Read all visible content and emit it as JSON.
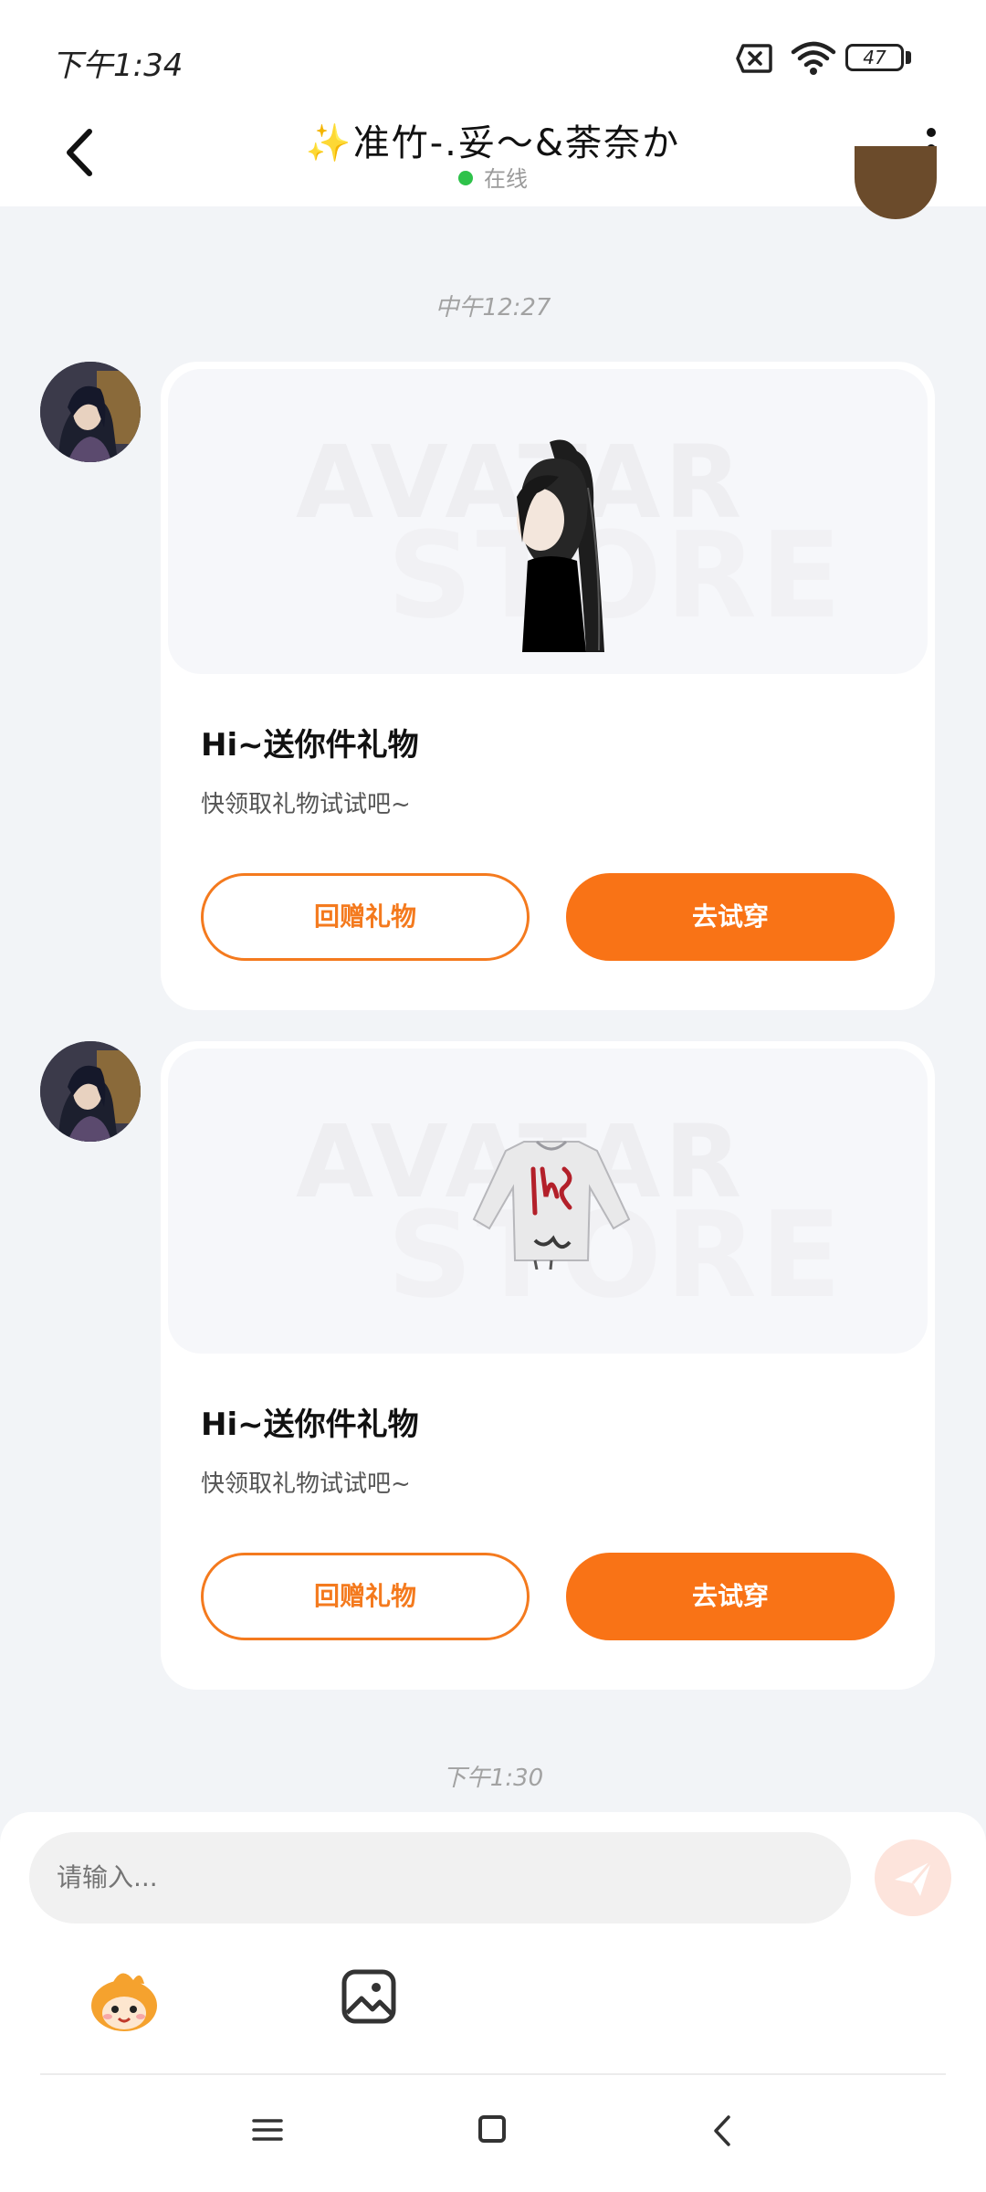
{
  "status_bar": {
    "time": "下午1:34",
    "battery": "47"
  },
  "header": {
    "title": "✨准竹-.妥～&荼奈か",
    "presence": "在线"
  },
  "messages": [
    {
      "type": "timestamp",
      "text": "中午12:27"
    },
    {
      "type": "gift",
      "title": "Hi~送你件礼物",
      "subtitle": "快领取礼物试试吧~",
      "return_label": "回赠礼物",
      "try_label": "去试穿",
      "watermark": [
        "AVATAR",
        "STORE"
      ],
      "item": "hair"
    },
    {
      "type": "gift",
      "title": "Hi~送你件礼物",
      "subtitle": "快领取礼物试试吧~",
      "return_label": "回赠礼物",
      "try_label": "去试穿",
      "watermark": [
        "AVATAR",
        "STORE"
      ],
      "item": "jacket"
    },
    {
      "type": "timestamp",
      "text": "下午1:30"
    }
  ],
  "composer": {
    "placeholder": "请输入..."
  },
  "colors": {
    "accent": "#f97316",
    "online": "#2ec24a",
    "background": "#f2f4f7"
  }
}
